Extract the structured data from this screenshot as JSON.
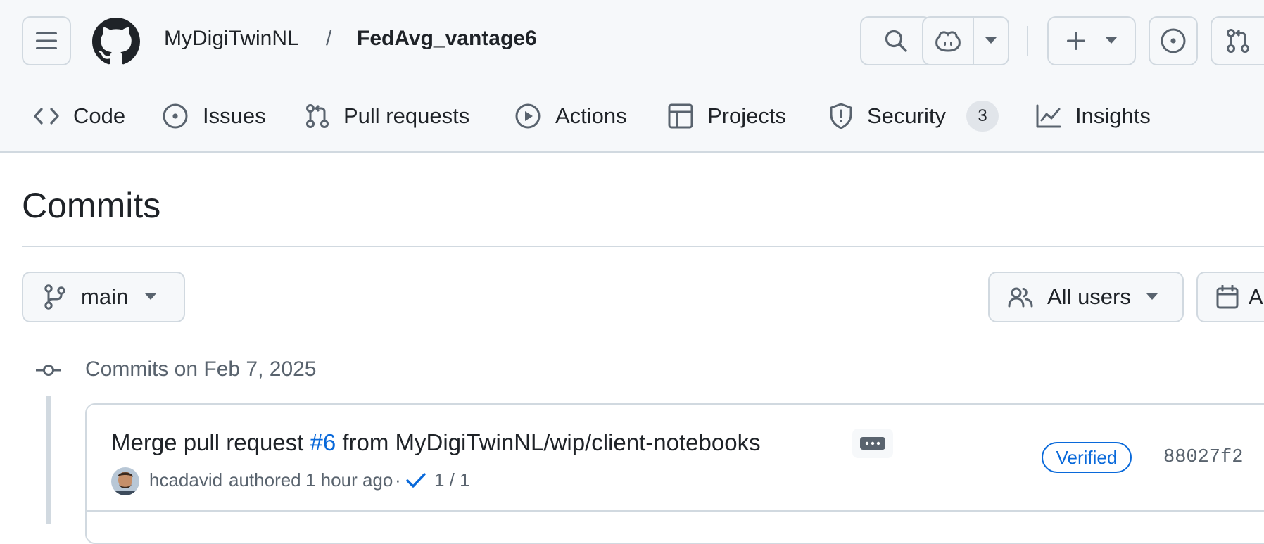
{
  "header": {
    "owner": "MyDigiTwinNL",
    "separator": "/",
    "repo": "FedAvg_vantage6",
    "icons": [
      "hamburger-icon",
      "github-logo-icon",
      "search-icon",
      "copilot-icon",
      "triangle-down-icon",
      "plus-icon",
      "issue-opened-icon",
      "git-pull-request-icon"
    ]
  },
  "tabs": [
    {
      "label": "Code",
      "icon": "code-icon"
    },
    {
      "label": "Issues",
      "icon": "issue-opened-icon"
    },
    {
      "label": "Pull requests",
      "icon": "git-pull-request-icon"
    },
    {
      "label": "Actions",
      "icon": "play-icon"
    },
    {
      "label": "Projects",
      "icon": "table-icon"
    },
    {
      "label": "Security",
      "icon": "shield-icon",
      "counter": "3"
    },
    {
      "label": "Insights",
      "icon": "graph-icon"
    }
  ],
  "page": {
    "title": "Commits"
  },
  "filters": {
    "branch": "main",
    "users": "All users",
    "date": "A"
  },
  "group": {
    "heading": "Commits on Feb 7, 2025"
  },
  "commit": {
    "title_prefix": "Merge pull request ",
    "pr_link": "#6",
    "title_suffix": " from MyDigiTwinNL/wip/client-notebooks",
    "author": "hcadavid",
    "authored": "authored",
    "time": "1 hour ago",
    "dot": "·",
    "checks": "1 / 1",
    "verified": "Verified",
    "sha": "88027f2"
  },
  "colors": {
    "accent": "#0969da",
    "success": "#1a7f37",
    "border": "#d1d9e0",
    "header_bg": "#f6f8fa",
    "muted": "#59636e"
  }
}
